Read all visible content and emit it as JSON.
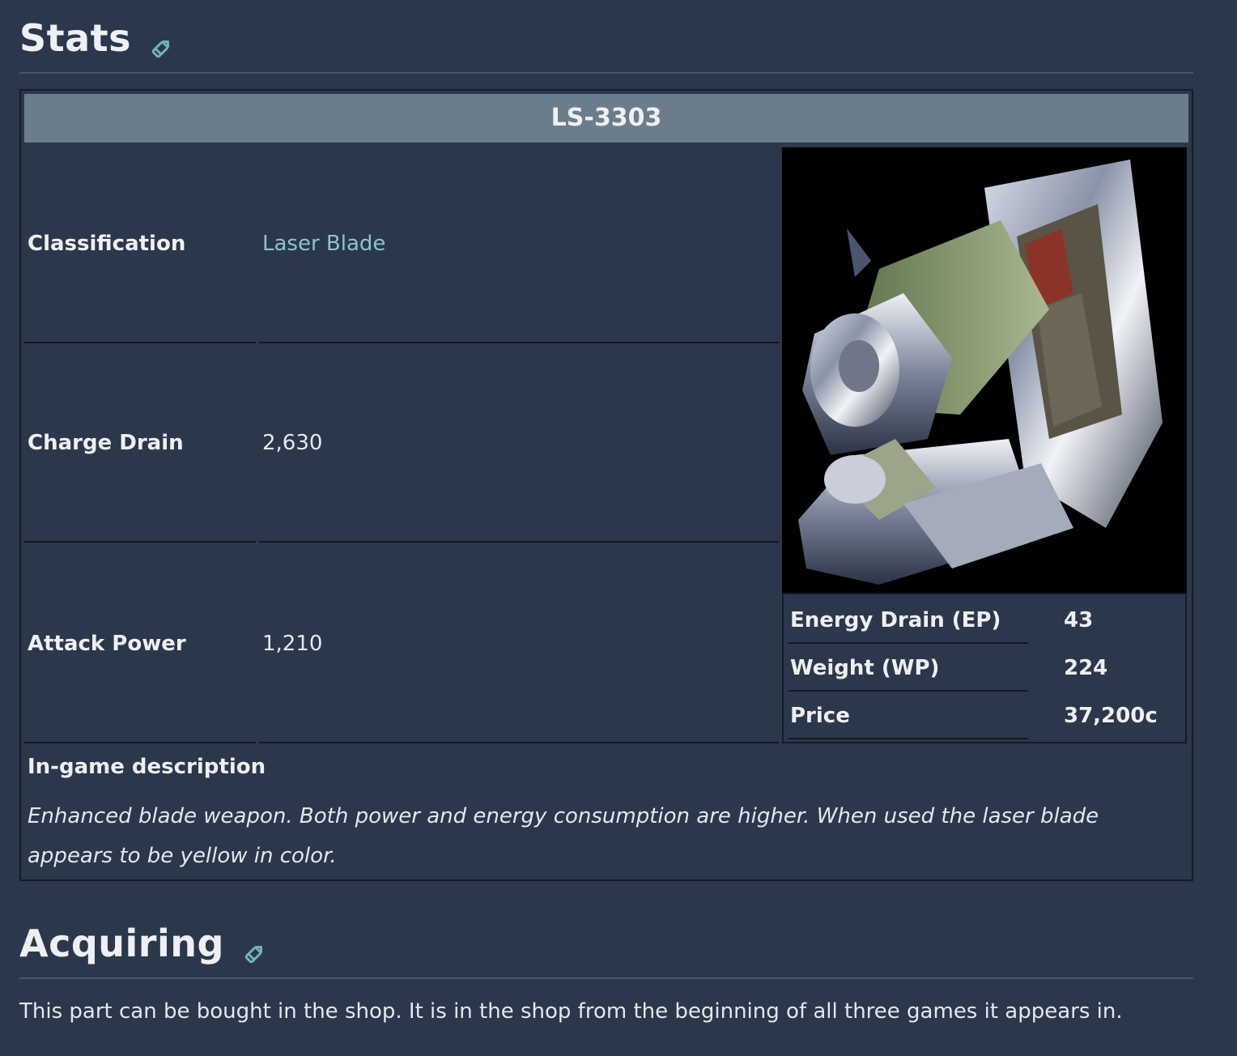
{
  "stats_section": {
    "heading": "Stats",
    "edit_icon": "pencil-icon"
  },
  "infobox": {
    "title": "LS-3303",
    "rows": [
      {
        "label": "Classification",
        "value": "Laser Blade"
      },
      {
        "label": "Charge Drain",
        "value": "2,630"
      },
      {
        "label": "Attack Power",
        "value": "1,210"
      }
    ],
    "side_rows": [
      {
        "label": "Energy Drain (EP)",
        "value": "43"
      },
      {
        "label": "Weight (WP)",
        "value": "224"
      },
      {
        "label": "Price",
        "value": "37,200c"
      }
    ],
    "description_label": "In-game description",
    "description": "Enhanced blade weapon. Both power and energy consumption are higher. When used the laser blade appears to be yellow in color."
  },
  "acquiring_section": {
    "heading": "Acquiring",
    "edit_icon": "pencil-icon",
    "text": "This part can be bought in the shop. It is in the shop from the beginning of all three games it appears in."
  },
  "colors": {
    "background": "#2b374a",
    "title_bar": "#6b7d8c",
    "link": "#8cc4c9",
    "edit_icon": "#6fb3bb"
  }
}
